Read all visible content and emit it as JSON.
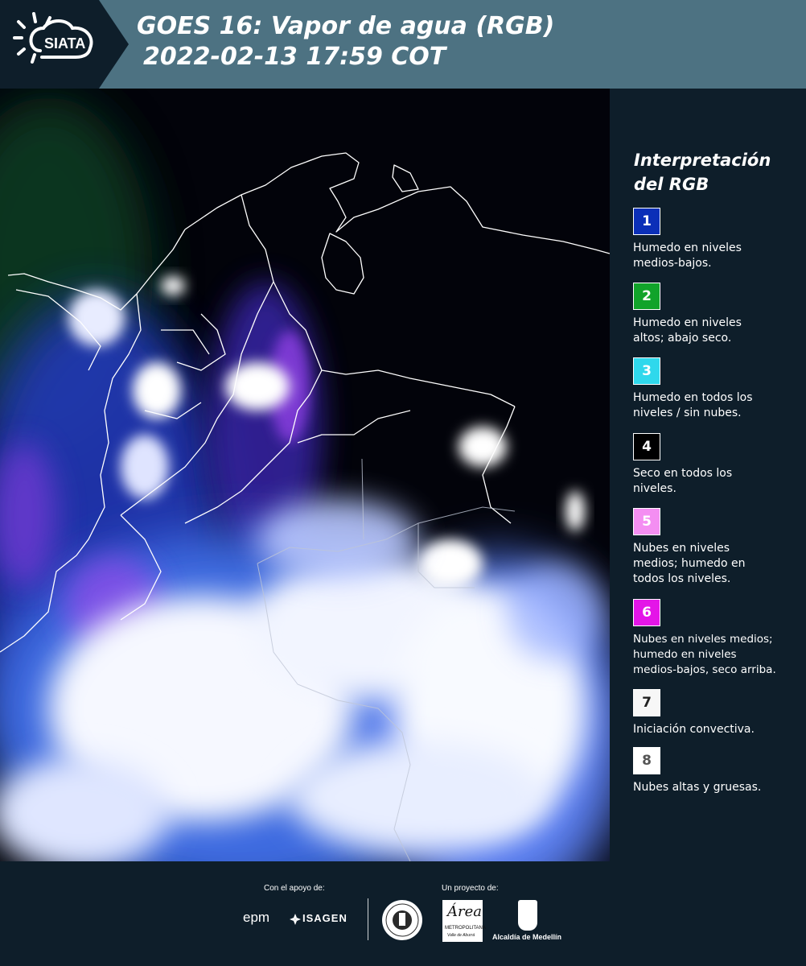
{
  "header": {
    "logo_text": "SIATA",
    "title_line1": "GOES 16: Vapor de agua (RGB)",
    "title_line2": "2022-02-13 17:59 COT"
  },
  "legend": {
    "title_line1": "Interpretación",
    "title_line2": "del RGB",
    "items": [
      {
        "number": "1",
        "color": "#0b2fb8",
        "text_color": "#ffffff",
        "label_lines": [
          "Humedo en niveles",
          "medios-bajos."
        ]
      },
      {
        "number": "2",
        "color": "#11a32a",
        "text_color": "#ffffff",
        "label_lines": [
          "Humedo en niveles",
          "altos; abajo seco."
        ]
      },
      {
        "number": "3",
        "color": "#2fd8ec",
        "text_color": "#ffffff",
        "label_lines": [
          "Humedo en todos los",
          "niveles / sin nubes."
        ]
      },
      {
        "number": "4",
        "color": "#000000",
        "text_color": "#ffffff",
        "label_lines": [
          "Seco en todos los",
          "niveles."
        ]
      },
      {
        "number": "5",
        "color": "#f48ef2",
        "text_color": "#ffffff",
        "label_lines": [
          "Nubes en niveles",
          "medios; humedo en",
          "todos los niveles."
        ]
      },
      {
        "number": "6",
        "color": "#e415e8",
        "text_color": "#ffffff",
        "label_lines": [
          "Nubes en niveles medios;",
          "humedo en niveles",
          "medios-bajos, seco arriba."
        ]
      },
      {
        "number": "7",
        "color": "#f7f7f7",
        "text_color": "#222222",
        "label_lines": [
          "Iniciación convectiva."
        ]
      },
      {
        "number": "8",
        "color": "#ffffff",
        "text_color": "#555555",
        "label_lines": [
          "Nubes altas y gruesas."
        ]
      }
    ]
  },
  "footer": {
    "support_label": "Con el apoyo de:",
    "project_label": "Un proyecto de:",
    "epm_logo": "epm",
    "isagen_logo": "ISAGEN",
    "area_logo": "Área",
    "area_sub": "METROPOLITANA",
    "area_sub2": "Valle de Aburrá",
    "alcaldia_logo": "Alcaldía de Medellín"
  }
}
